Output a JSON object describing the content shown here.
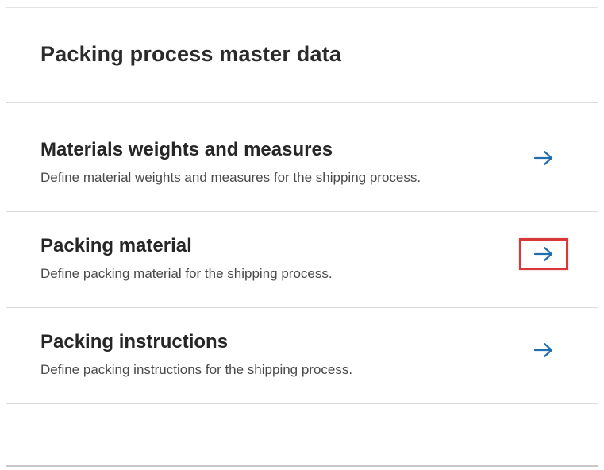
{
  "panel": {
    "title": "Packing process master data"
  },
  "items": [
    {
      "title": "Materials weights and measures",
      "description": "Define material weights and measures for the shipping process.",
      "icon": "arrow-right-icon"
    },
    {
      "title": "Packing material",
      "description": "Define packing material for the shipping process.",
      "icon": "arrow-right-icon",
      "highlighted": true
    },
    {
      "title": "Packing instructions",
      "description": "Define packing instructions for the shipping process.",
      "icon": "arrow-right-icon"
    }
  ],
  "colors": {
    "accent": "#1f6fb2",
    "highlight_box": "#d9383a",
    "title_text": "#2b2b2b",
    "description_text": "#4a4a4a",
    "divider": "#dcdcdc"
  }
}
